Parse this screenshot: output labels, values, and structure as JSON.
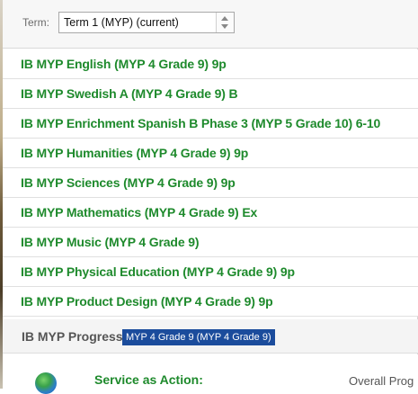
{
  "term": {
    "label": "Term:",
    "selected": "Term 1 (MYP) (current)"
  },
  "classes": [
    "IB MYP English (MYP 4 Grade 9) 9p",
    "IB MYP Swedish A (MYP 4 Grade 9) B",
    "IB MYP Enrichment Spanish B Phase 3 (MYP 5 Grade 10) 6-10",
    "IB MYP Humanities (MYP 4 Grade 9) 9p",
    "IB MYP Sciences (MYP 4 Grade 9) 9p",
    "IB MYP Mathematics (MYP 4 Grade 9) Ex",
    "IB MYP Music (MYP 4 Grade 9)",
    "IB MYP Physical Education (MYP 4 Grade 9) 9p",
    "IB MYP Product Design (MYP 4 Grade 9) 9p"
  ],
  "progress": {
    "title": "IB MYP Progress",
    "badge": "MYP 4 Grade 9 (MYP 4 Grade 9)"
  },
  "service": {
    "icon": "globe-icon",
    "title": "Service as Action:",
    "overall_label": "Overall Prog"
  },
  "colors": {
    "link_green": "#1e8a2c",
    "badge_blue": "#1b4c9c"
  }
}
